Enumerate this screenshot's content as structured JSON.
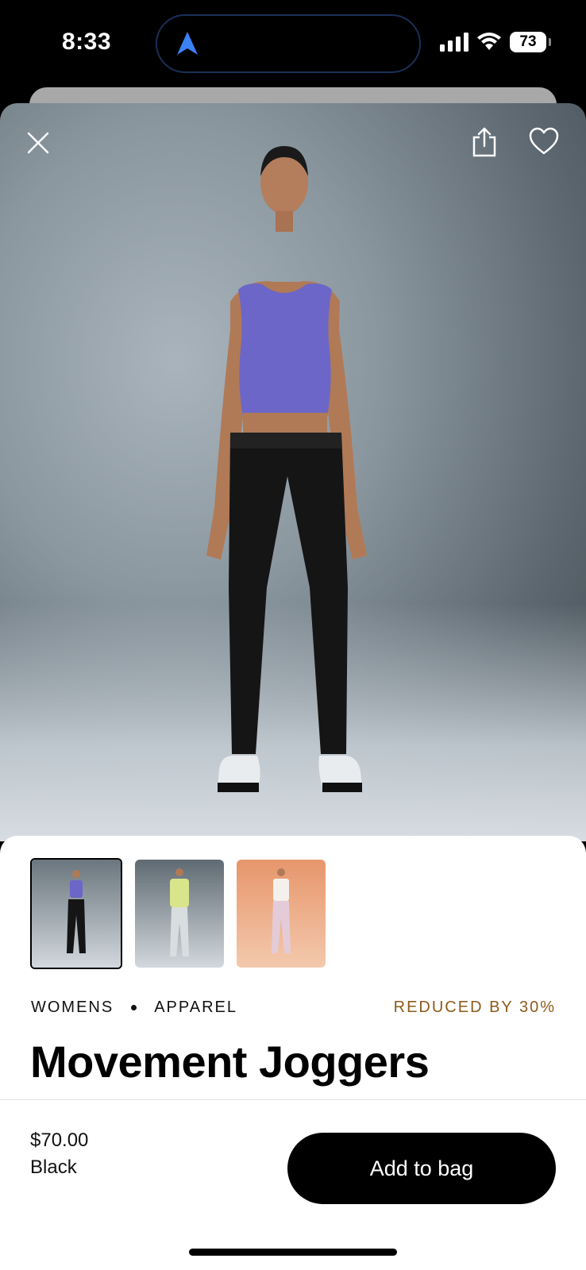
{
  "status_bar": {
    "time": "8:33",
    "battery": "73",
    "icons": [
      "location-arrow-icon",
      "signal-icon",
      "wifi-icon",
      "battery-icon"
    ]
  },
  "hero": {
    "actions": [
      "close-icon",
      "share-icon",
      "heart-icon"
    ],
    "carousel": {
      "count": 3,
      "active_index": 1
    }
  },
  "thumbnails": [
    {
      "name": "Purple top with black joggers",
      "selected": true
    },
    {
      "name": "Lime vest with grey joggers",
      "selected": false
    },
    {
      "name": "White tank with pink joggers",
      "selected": false
    }
  ],
  "product": {
    "category": "WOMENS",
    "subcategory": "APPAREL",
    "badge": "REDUCED BY 30%",
    "title": "Movement Joggers",
    "price": "$70.00",
    "color": "Black"
  },
  "cta": {
    "add_to_bag": "Add to bag"
  },
  "colors": {
    "accent_badge": "#8c5a1b",
    "primary_button": "#000000"
  }
}
